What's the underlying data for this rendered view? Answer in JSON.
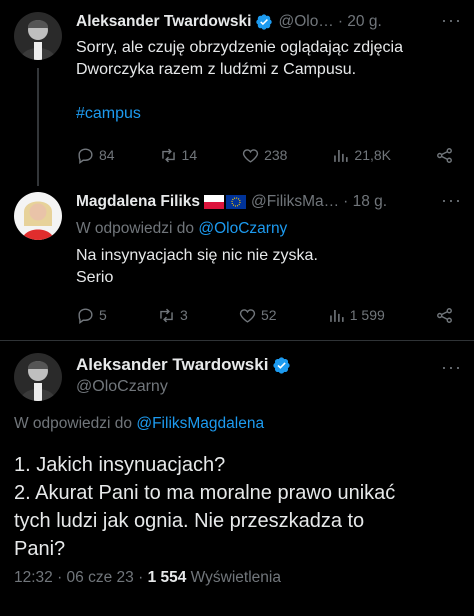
{
  "tweets": [
    {
      "author_name": "Aleksander Twardowski",
      "handle": "@Olo…",
      "time": "· 20 g.",
      "text_line1": "Sorry, ale czuję obrzydzenie oglądając zdjęcia",
      "text_line2": "Dworczyka razem z ludźmi z Campusu.",
      "hashtag": "#campus",
      "replies": "84",
      "retweets": "14",
      "likes": "238",
      "views": "21,8K",
      "more_label": "···"
    },
    {
      "author_name": "Magdalena Filiks",
      "handle": "@FiliksMa…",
      "time": "· 18 g.",
      "reply_prefix": "W odpowiedzi do",
      "reply_handle": "@OloCzarny",
      "text_line1": "Na insynyacjach się nic nie zyska.",
      "text_line2": "Serio",
      "replies": "5",
      "retweets": "3",
      "likes": "52",
      "views": "1 599",
      "more_label": "···"
    }
  ],
  "main_tweet": {
    "author_name": "Aleksander Twardowski",
    "handle": "@OloCzarny",
    "reply_prefix": "W odpowiedzi do",
    "reply_handle": "@FiliksMagdalena",
    "line1": "1. Jakich insynuacjach?",
    "line2": "2. Akurat Pani to ma moralne prawo unikać",
    "line3": "tych ludzi jak ognia. Nie przeszkadza to",
    "line4": "Pani?",
    "time": "12:32 · 06 cze 23 · ",
    "views_count": "1 554",
    "views_label": " Wyświetlenia",
    "more_label": "···"
  },
  "colors": {
    "background": "#000000",
    "text": "#e7e9ea",
    "muted": "#71767b",
    "accent": "#1d9bf0",
    "divider": "#2f3336"
  }
}
